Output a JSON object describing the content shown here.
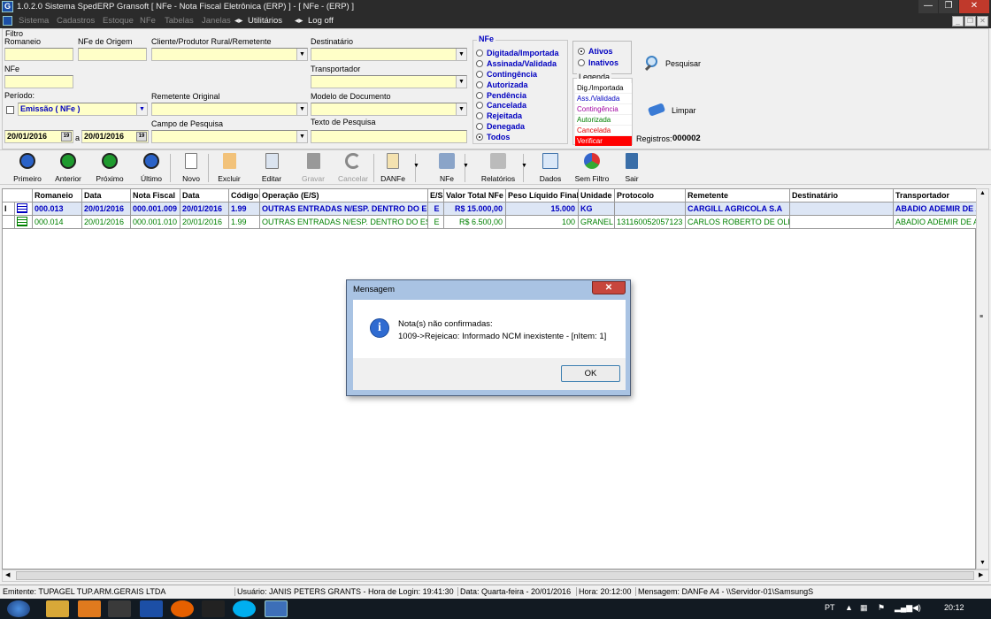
{
  "window": {
    "title": "1.0.2.0   Sistema SpedERP Gransoft [ NFe - Nota Fiscal Eletrônica (ERP) ] - [ NFe - (ERP) ]",
    "controls": [
      "—",
      "❐",
      "✕"
    ]
  },
  "menu": [
    {
      "label": "Sistema",
      "enabled": false
    },
    {
      "label": "Cadastros",
      "enabled": false
    },
    {
      "label": "Estoque",
      "enabled": false
    },
    {
      "label": "NFe",
      "enabled": false
    },
    {
      "label": "Tabelas",
      "enabled": false
    },
    {
      "label": "Janelas",
      "enabled": false
    },
    {
      "label": "Utilitários",
      "enabled": true
    },
    {
      "label": "Log off",
      "enabled": true
    }
  ],
  "filter": {
    "caption": "Filtro",
    "romaneio_label": "Romaneio",
    "romaneio_value": "",
    "nfe_origem_label": "NFe de Origem",
    "nfe_origem_value": "",
    "cliente_label": "Cliente/Produtor Rural/Remetente",
    "cliente_value": "",
    "destinatario_label": "Destinatário",
    "destinatario_value": "",
    "nfe_label": "NFe",
    "nfe_value": "",
    "transportador_label": "Transportador",
    "transportador_value": "",
    "periodo_label": "Período:",
    "periodo_value": "Emissão  ( NFe )",
    "remetente_original_label": "Remetente Original",
    "remetente_original_value": "",
    "modelo_label": "Modelo de Documento",
    "modelo_value": "",
    "campo_pesquisa_label": "Campo de Pesquisa",
    "campo_pesquisa_value": "",
    "texto_pesquisa_label": "Texto de Pesquisa",
    "texto_pesquisa_value": "",
    "date_from": "20/01/2016",
    "date_sep": "a",
    "date_to": "20/01/2016"
  },
  "nfe_group": {
    "caption": "NFe",
    "options": [
      "Digitada/Importada",
      "Assinada/Validada",
      "Contingência",
      "Autorizada",
      "Pendência",
      "Cancelada",
      "Rejeitada",
      "Denegada",
      "Todos"
    ],
    "selected": "Todos"
  },
  "status_group": {
    "options": [
      "Ativos",
      "Inativos"
    ],
    "selected": "Ativos"
  },
  "legend": {
    "caption": "Legenda",
    "items": [
      {
        "label": "Dig./Importada",
        "color": "#000000",
        "bg": "#ffffff"
      },
      {
        "label": "Ass./Validada",
        "color": "#0000c0",
        "bg": "#ffffff"
      },
      {
        "label": "Contingência",
        "color": "#a000a0",
        "bg": "#ffffff"
      },
      {
        "label": "Autorizada",
        "color": "#008000",
        "bg": "#ffffff"
      },
      {
        "label": "Cancelada",
        "color": "#e00000",
        "bg": "#ffffff"
      },
      {
        "label": "Verificar",
        "color": "#ffffff",
        "bg": "#ff0000"
      }
    ]
  },
  "actions": {
    "pesquisar": "Pesquisar",
    "limpar": "Limpar",
    "registros_label": "Registros:",
    "registros_value": "000002"
  },
  "toolbar": [
    {
      "label": "Primeiro",
      "icon": "first-icon",
      "enabled": true
    },
    {
      "label": "Anterior",
      "icon": "previous-icon",
      "enabled": true
    },
    {
      "label": "Próximo",
      "icon": "next-icon",
      "enabled": true
    },
    {
      "label": "Último",
      "icon": "last-icon",
      "enabled": true
    },
    {
      "label": "Novo",
      "icon": "new-document-icon",
      "enabled": true
    },
    {
      "label": "Excluir",
      "icon": "delete-icon",
      "enabled": true
    },
    {
      "label": "Editar",
      "icon": "edit-icon",
      "enabled": true
    },
    {
      "label": "Gravar",
      "icon": "save-icon",
      "enabled": false
    },
    {
      "label": "Cancelar",
      "icon": "undo-icon",
      "enabled": false
    },
    {
      "label": "DANFe",
      "icon": "danfe-icon",
      "enabled": true
    },
    {
      "label": "NFe",
      "icon": "nfe-icon",
      "enabled": true
    },
    {
      "label": "Relatórios",
      "icon": "printer-icon",
      "enabled": true
    },
    {
      "label": "Dados",
      "icon": "table-icon",
      "enabled": true
    },
    {
      "label": "Sem Filtro",
      "icon": "filter-icon",
      "enabled": true
    },
    {
      "label": "Sair",
      "icon": "exit-icon",
      "enabled": true
    }
  ],
  "grid": {
    "columns": [
      "Romaneio",
      "Data",
      "Nota Fiscal",
      "Data",
      "Código",
      "Operação (E/S)",
      "E/S",
      "Valor Total NFe",
      "Peso Líquido Final",
      "Unidade",
      "Protocolo",
      "Remetente",
      "Destinatário",
      "Transportador"
    ],
    "rows": [
      {
        "indicator": "I",
        "cells": [
          "000.013",
          "20/01/2016",
          "000.001.009",
          "20/01/2016",
          "1.99",
          "OUTRAS ENTRADAS N/ESP. DENTRO DO ESTADO",
          "E",
          "R$ 15.000,00",
          "15.000",
          "KG",
          "",
          "CARGILL AGRICOLA S.A",
          "",
          "ABADIO ADEMIR DE ANDRADE"
        ],
        "color": "#0000c0",
        "bg": "#dde6f5",
        "bold": true
      },
      {
        "indicator": "",
        "cells": [
          "000.014",
          "20/01/2016",
          "000.001.010",
          "20/01/2016",
          "1.99",
          "OUTRAS ENTRADAS N/ESP. DENTRO DO ESTADO",
          "E",
          "R$ 6.500,00",
          "100",
          "GRANEL",
          "131160052057123",
          "CARLOS ROBERTO DE OLIVEIRA",
          "",
          "ABADIO ADEMIR DE ANDRADE"
        ],
        "color": "#008000",
        "bg": "#ffffff",
        "bold": false
      }
    ]
  },
  "statusbar": {
    "emitente": "Emitente: TUPAGEL TUP.ARM.GERAIS LTDA",
    "usuario": "Usuário: JANIS PETERS GRANTS - Hora de Login: 19:41:30",
    "data": "Data: Quarta-feira - 20/01/2016",
    "hora": "Hora: 20:12:00",
    "mensagem": "Mensagem: DANFe A4 - \\\\Servidor-01\\SamsungS"
  },
  "dialog": {
    "title": "Mensagem",
    "close": "✕",
    "line1": "Nota(s) não confirmadas:",
    "line2": "1009->Rejeicao: Informado NCM inexistente - [nItem: 1]",
    "ok": "OK"
  },
  "taskbar": {
    "lang": "PT",
    "clock": "20:12"
  }
}
